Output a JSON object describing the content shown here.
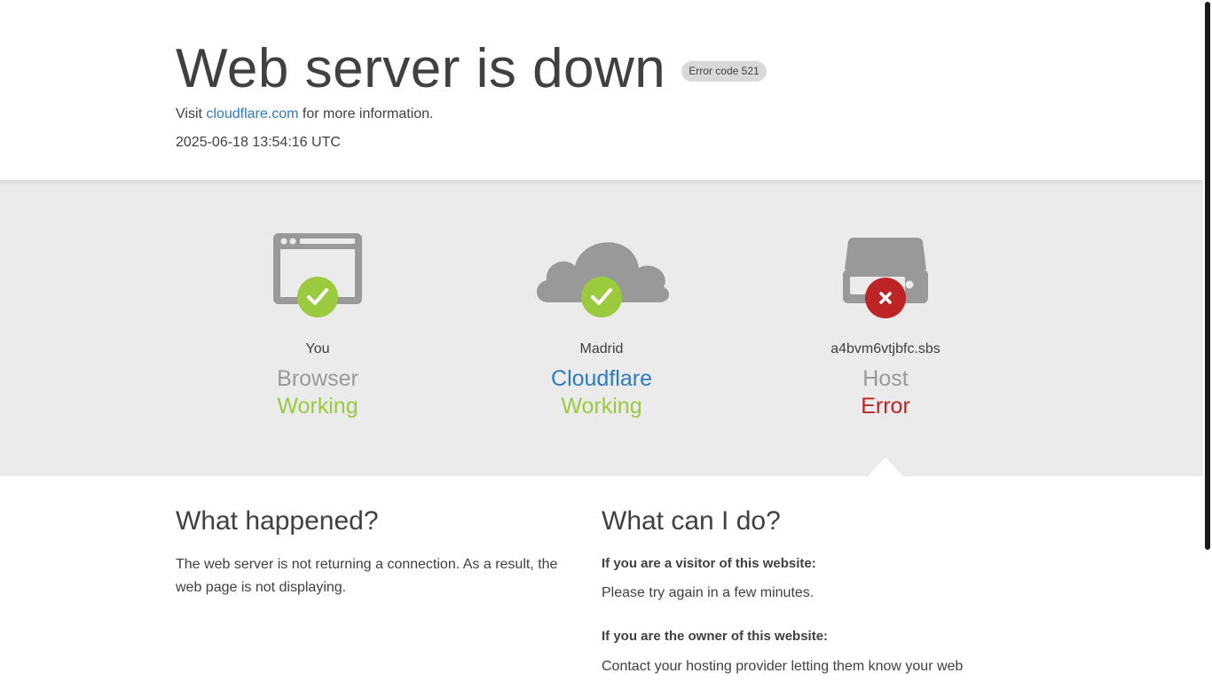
{
  "header": {
    "title": "Web server is down",
    "error_badge": "Error code 521",
    "visit_prefix": "Visit",
    "visit_link": "cloudflare.com",
    "visit_suffix": "for more information.",
    "timestamp": "2025-06-18 13:54:16 UTC"
  },
  "status": {
    "columns": [
      {
        "location": "You",
        "name": "Browser",
        "state": "Working",
        "state_type": "ok",
        "icon": "browser-icon"
      },
      {
        "location": "Madrid",
        "name": "Cloudflare",
        "state": "Working",
        "state_type": "ok",
        "icon": "cloud-icon"
      },
      {
        "location": "a4bvm6vtjbfc.sbs",
        "name": "Host",
        "state": "Error",
        "state_type": "error",
        "icon": "server-icon"
      }
    ]
  },
  "what_happened": {
    "heading": "What happened?",
    "body": "The web server is not returning a connection. As a result, the web page is not displaying."
  },
  "what_can_i_do": {
    "heading": "What can I do?",
    "visitor_heading": "If you are a visitor of this website:",
    "visitor_body": "Please try again in a few minutes.",
    "owner_heading": "If you are the owner of this website:",
    "owner_body": "Contact your hosting provider letting them know your web"
  },
  "colors": {
    "ok": "#9bca3e",
    "error": "#bd2426",
    "link": "#2f7bbf",
    "icon_gray": "#999999"
  }
}
